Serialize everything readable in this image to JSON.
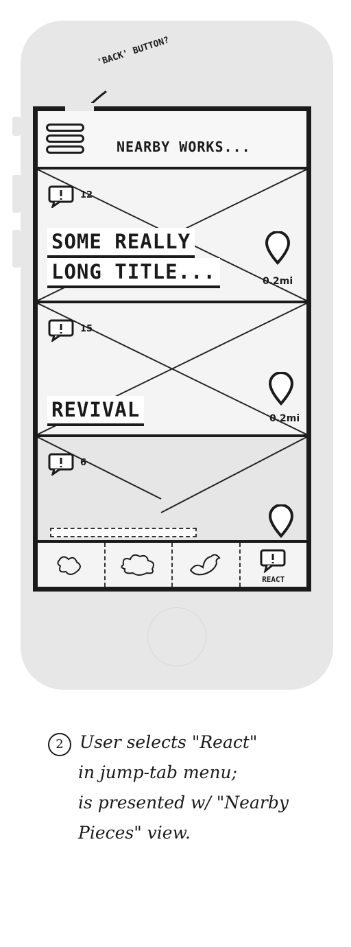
{
  "annotation": {
    "back_button_note": "'BACK' BUTTON?"
  },
  "header": {
    "title": "NEARBY WORKS...",
    "menu_icon": "hamburger-menu-icon"
  },
  "works": [
    {
      "comment_count": "12",
      "title_lines": [
        "SOME REALLY",
        "LONG TITLE..."
      ],
      "distance": "0.2mi"
    },
    {
      "comment_count": "15",
      "title_lines": [
        "REVIVAL"
      ],
      "distance": "0.2mi"
    },
    {
      "comment_count": "6",
      "title_lines": [],
      "distance": ""
    }
  ],
  "tabbar": {
    "tabs": [
      {
        "icon": "squiggle-icon",
        "label": ""
      },
      {
        "icon": "cloud-shape-icon",
        "label": ""
      },
      {
        "icon": "bird-icon",
        "label": ""
      },
      {
        "icon": "react-comment-icon",
        "label": "REACT"
      }
    ]
  },
  "caption": {
    "step_number": "2",
    "lines": [
      "User selects \"React\"",
      "in jump-tab menu;",
      "is presented w/ \"Nearby",
      "Pieces\" view."
    ]
  }
}
